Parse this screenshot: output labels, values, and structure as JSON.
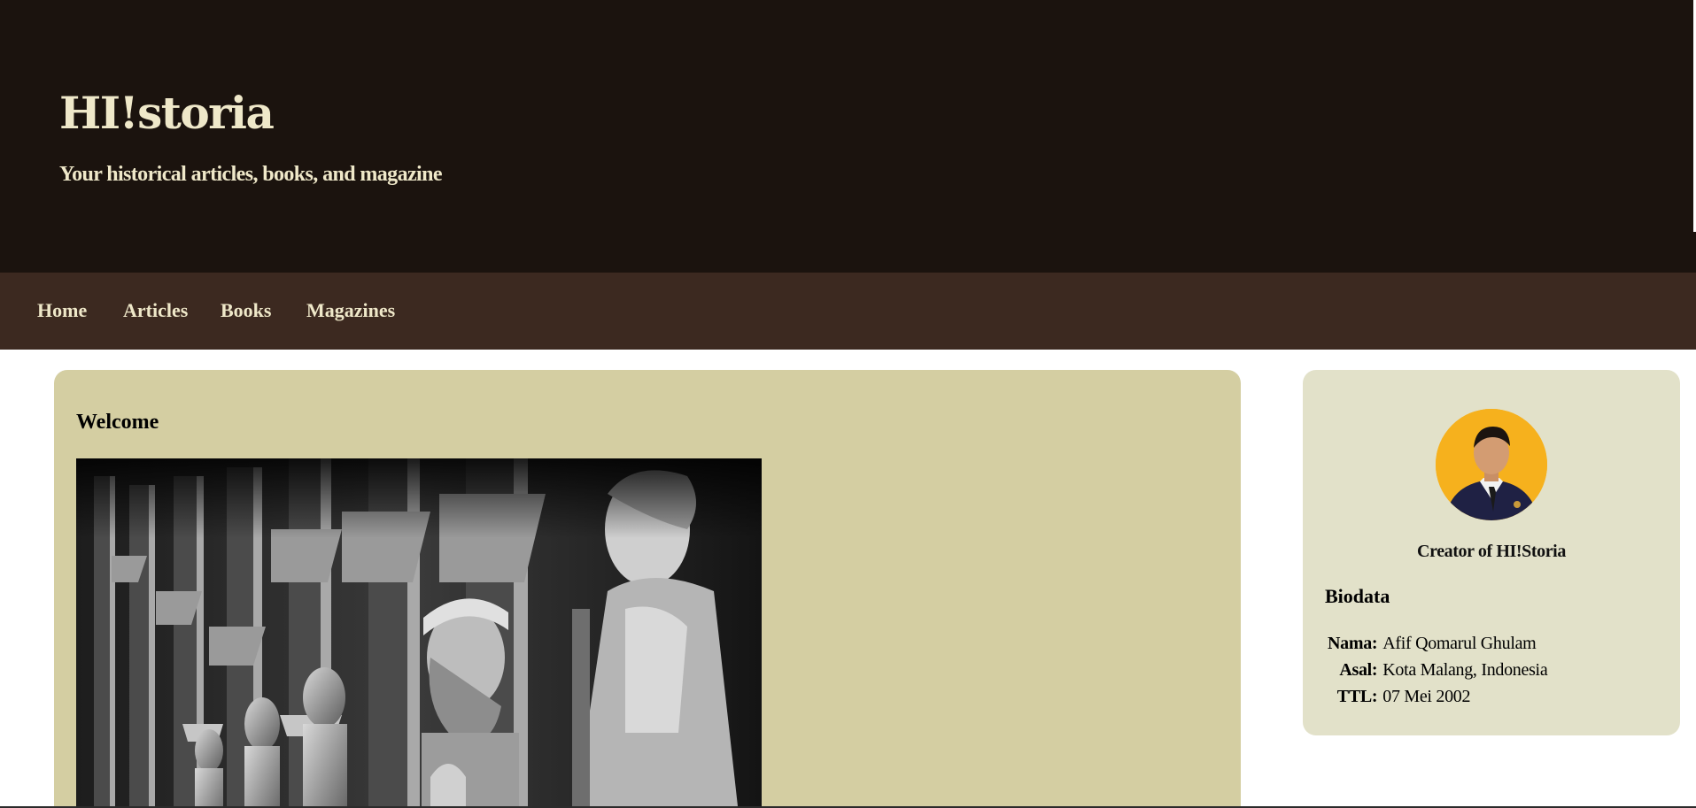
{
  "header": {
    "title": "HI!storia",
    "tagline": "Your historical articles, books, and magazine"
  },
  "nav": {
    "items": [
      {
        "label": "Home"
      },
      {
        "label": "Articles"
      },
      {
        "label": "Books"
      },
      {
        "label": "Magazines"
      }
    ]
  },
  "main": {
    "welcome_title": "Welcome",
    "hero_image": {
      "description_icon": "statues-photo"
    }
  },
  "sidebar": {
    "creator_caption": "Creator of HI!Storia",
    "biodata_title": "Biodata",
    "biodata": [
      {
        "label": "Nama:",
        "value": "Afif Qomarul Ghulam"
      },
      {
        "label": "Asal:",
        "value": "Kota Malang, Indonesia"
      },
      {
        "label": "TTL:",
        "value": "07 Mei 2002"
      }
    ]
  },
  "colors": {
    "header_bg": "#1b130e",
    "nav_bg": "#3c2920",
    "title_text": "#efe8c9",
    "main_card_bg": "#d4cea2",
    "side_card_bg": "#e2e1c9",
    "avatar_bg": "#f6b11d"
  }
}
